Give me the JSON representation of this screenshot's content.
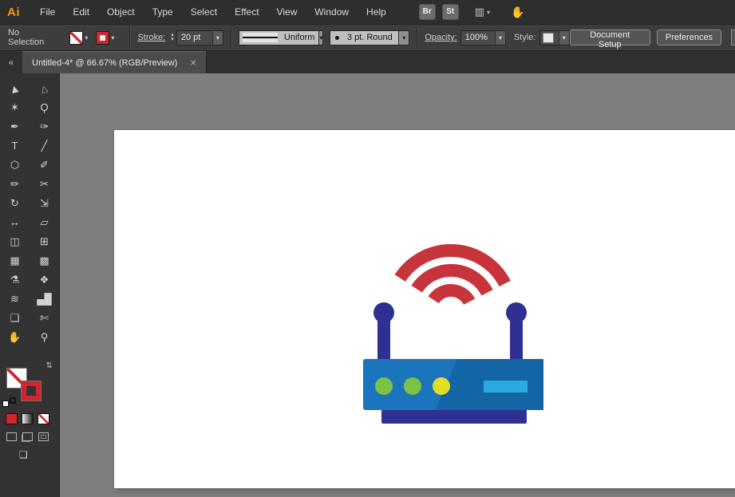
{
  "app": {
    "logo_text": "Ai",
    "logo_color": "#f7941d",
    "menus": [
      "File",
      "Edit",
      "Object",
      "Type",
      "Select",
      "Effect",
      "View",
      "Window",
      "Help"
    ],
    "quick_buttons": [
      "Br",
      "St"
    ]
  },
  "icons": {
    "chevron_down": "▾",
    "stepper_up": "▴",
    "stepper_down": "▾",
    "collapse_panel": "«",
    "workspace_grid": "▥",
    "touch_hand": "✋",
    "swap_fill_stroke": "⇄",
    "screen_mode": "❑",
    "close_tab": "×"
  },
  "control_bar": {
    "selection_status": "No Selection",
    "stroke_label": "Stroke:",
    "stroke_weight": "20 pt",
    "width_profile": "Uniform",
    "brush_name": "3 pt. Round",
    "opacity_label": "Opacity:",
    "opacity_value": "100%",
    "style_label": "Style:",
    "document_setup_button": "Document Setup",
    "preferences_button": "Preferences"
  },
  "tab_bar": {
    "tab_title": "Untitled-4* @ 66.67% (RGB/Preview)"
  },
  "tools": [
    {
      "name": "selection-tool",
      "glyph": "▶"
    },
    {
      "name": "direct-selection-tool",
      "glyph": "▷"
    },
    {
      "name": "magic-wand-tool",
      "glyph": "✶"
    },
    {
      "name": "lasso-tool",
      "glyph": "Ϙ"
    },
    {
      "name": "pen-tool",
      "glyph": "✒"
    },
    {
      "name": "curvature-tool",
      "glyph": "✑"
    },
    {
      "name": "type-tool",
      "glyph": "T"
    },
    {
      "name": "line-segment-tool",
      "glyph": "╱"
    },
    {
      "name": "shape-tool",
      "glyph": "⬡"
    },
    {
      "name": "paintbrush-tool",
      "glyph": "✐"
    },
    {
      "name": "shaper-tool",
      "glyph": "✏"
    },
    {
      "name": "scissors-tool",
      "glyph": "✂"
    },
    {
      "name": "rotate-tool",
      "glyph": "↻"
    },
    {
      "name": "scale-tool",
      "glyph": "⇲"
    },
    {
      "name": "width-tool",
      "glyph": "↔"
    },
    {
      "name": "free-transform-tool",
      "glyph": "▱"
    },
    {
      "name": "shape-builder-tool",
      "glyph": "◫"
    },
    {
      "name": "perspective-grid-tool",
      "glyph": "⊞"
    },
    {
      "name": "mesh-tool",
      "glyph": "▦"
    },
    {
      "name": "gradient-tool",
      "glyph": "▩"
    },
    {
      "name": "eyedropper-tool",
      "glyph": "⚗"
    },
    {
      "name": "blend-tool",
      "glyph": "❖"
    },
    {
      "name": "symbol-sprayer-tool",
      "glyph": "≋"
    },
    {
      "name": "column-graph-tool",
      "glyph": "▄█"
    },
    {
      "name": "artboard-tool",
      "glyph": "❏"
    },
    {
      "name": "slice-tool",
      "glyph": "✄"
    },
    {
      "name": "hand-tool",
      "glyph": "✋"
    },
    {
      "name": "zoom-tool",
      "glyph": "⚲"
    }
  ],
  "ui_colors": {
    "accent_red": "#d2262e",
    "canvas_gray": "#7f7f7f"
  },
  "illustration": {
    "subject": "wifi-router",
    "wifi_color": "#c8343b",
    "antenna_color": "#2e3192",
    "body_color": "#1b75bc",
    "body_shadow_color": "#1465a5",
    "base_color": "#2e3192",
    "led1_color": "#7dc242",
    "led2_color": "#7dc242",
    "led3_color": "#e2de24",
    "port_color": "#29abe2"
  }
}
